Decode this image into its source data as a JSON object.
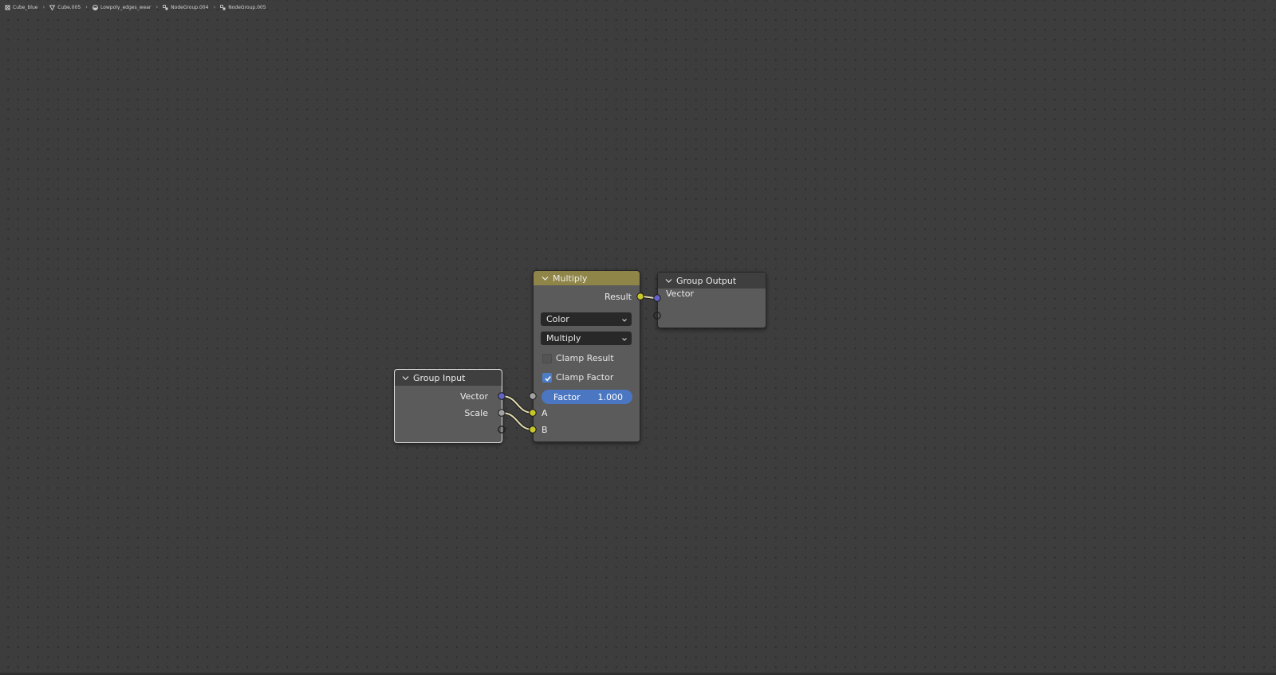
{
  "breadcrumb": [
    {
      "label": "Cube_blue",
      "icon": "object-icon"
    },
    {
      "label": "Cube.005",
      "icon": "mesh-icon"
    },
    {
      "label": "Lowpoly_edges_wear",
      "icon": "material-icon"
    },
    {
      "label": "NodeGroup.004",
      "icon": "node-group-icon"
    },
    {
      "label": "NodeGroup.005",
      "icon": "node-group-icon"
    }
  ],
  "nodes": {
    "group_input": {
      "title": "Group Input",
      "outputs": [
        "Vector",
        "Scale"
      ]
    },
    "multiply": {
      "title": "Multiply",
      "output": "Result",
      "data_type": "Color",
      "blend_mode": "Multiply",
      "clamp_result": {
        "label": "Clamp Result",
        "checked": false
      },
      "clamp_factor": {
        "label": "Clamp Factor",
        "checked": true
      },
      "factor": {
        "label": "Factor",
        "value": "1.000"
      },
      "inputs": [
        "A",
        "B"
      ]
    },
    "group_output": {
      "title": "Group Output",
      "inputs": [
        "Vector"
      ]
    }
  },
  "colors": {
    "canvas": "#3d3d3d",
    "node_body": "#5b5b5b",
    "mix_header": "#8f8548",
    "socket_vector": "#6363c7",
    "socket_color": "#c7c729",
    "socket_float": "#a1a1a1",
    "slider": "#4a76c2",
    "checkbox_on": "#4d7dc6"
  }
}
